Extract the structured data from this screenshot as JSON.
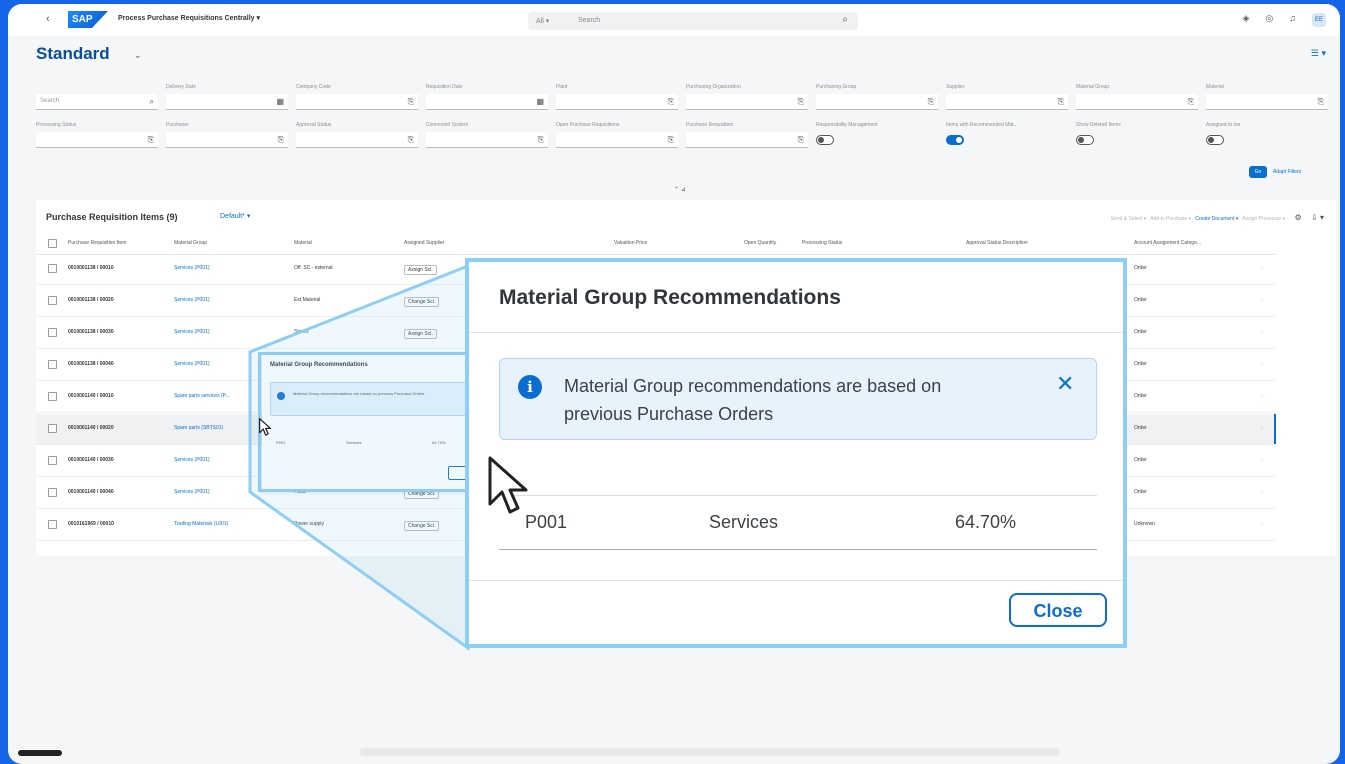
{
  "shell": {
    "app_title": "Process Purchase Requisitions Centrally ▾",
    "search_scope": "All ▾",
    "search_placeholder": "Search",
    "avatar_initials": "EE"
  },
  "variant": {
    "title": "Standard"
  },
  "filters": [
    {
      "label": "",
      "placeholder": "Search",
      "icon": "search-icon"
    },
    {
      "label": "Delivery Date",
      "icon": "calendar-icon"
    },
    {
      "label": "Company Code",
      "icon": "value-help-icon"
    },
    {
      "label": "Requisition Date",
      "icon": "calendar-icon"
    },
    {
      "label": "Plant",
      "icon": "value-help-icon"
    },
    {
      "label": "Purchasing Organization",
      "icon": "value-help-icon"
    },
    {
      "label": "Purchasing Group",
      "icon": "value-help-icon"
    },
    {
      "label": "Supplier",
      "icon": "value-help-icon"
    },
    {
      "label": "Material Group",
      "icon": "value-help-icon"
    },
    {
      "label": "Material",
      "icon": "value-help-icon"
    },
    {
      "label": "Processing Status",
      "icon": "value-help-icon"
    },
    {
      "label": "Purchaser",
      "icon": "value-help-icon"
    },
    {
      "label": "Approval Status",
      "icon": "value-help-icon"
    },
    {
      "label": "Connected System",
      "icon": "value-help-icon"
    },
    {
      "label": "Open Purchase Requisitions",
      "icon": "value-help-icon"
    },
    {
      "label": "Purchase Requisition",
      "icon": "value-help-icon"
    },
    {
      "label": "Responsibility Management",
      "toggle": false
    },
    {
      "label": "Items with Recommended Mat...",
      "toggle": true
    },
    {
      "label": "Show Deleted Items",
      "toggle": false
    },
    {
      "label": "Assigned to me",
      "toggle": false
    }
  ],
  "filter_bar": {
    "go_label": "Go",
    "adapt_label": "Adapt Filters"
  },
  "table": {
    "title": "Purchase Requisition Items (9)",
    "variant": "Default* ▾",
    "actions": [
      "Send & Select ▾",
      "Add to Purchase ▾",
      "Create Document ▾",
      "Assign Processor ▾"
    ],
    "columns": [
      "Purchase Requisition Item",
      "Material Group",
      "Material",
      "Assigned Supplier",
      "Valuation Price",
      "Open Quantity",
      "Processing Status",
      "Approval Status Description",
      "Account Assignment Catego..."
    ],
    "rows": [
      {
        "id": "0010001138 / 00010",
        "group": "Services (P001)",
        "material": "Off. SC - external",
        "supplier": "Assign Sci.",
        "acct": "Order"
      },
      {
        "id": "0010001138 / 00020",
        "group": "Services (P001)",
        "material": "Ext Material",
        "supplier": "Change Sci.",
        "acct": "Order"
      },
      {
        "id": "0010001138 / 00030",
        "group": "Services (P001)",
        "material": "Stores",
        "supplier": "Assign Sci.",
        "acct": "Order"
      },
      {
        "id": "0010001138 / 00040",
        "group": "Services (P001)",
        "material": "",
        "supplier": "",
        "acct": "Order"
      },
      {
        "id": "0010001140 / 00010",
        "group": "Spare parts services (P...",
        "material": "",
        "supplier": "",
        "acct": "Order"
      },
      {
        "id": "0010001140 / 00020",
        "group": "Spare parts (SBTS01)",
        "material": "",
        "supplier": "",
        "acct": "Order"
      },
      {
        "id": "0010001140 / 00030",
        "group": "Services (P001)",
        "material": "",
        "supplier": "",
        "acct": "Order"
      },
      {
        "id": "0010001140 / 00040",
        "group": "Services (P001)",
        "material": "Food",
        "supplier": "Change Sci.",
        "acct": "Order"
      },
      {
        "id": "0010161969 / 00010",
        "group": "Trading Materials (L001)",
        "material": "Power supply",
        "supplier": "Change Sci.",
        "acct": "Unknown"
      }
    ]
  },
  "mini_popover": {
    "title": "Material Group Recommendations",
    "message": "Material Group recommendations are based on previous Purchase Orders",
    "row": [
      "P001",
      "Services",
      "64.70%"
    ]
  },
  "dialog": {
    "title": "Material Group Recommendations",
    "message": "Material Group recommendations are based on previous Purchase Orders",
    "row": {
      "code": "P001",
      "group": "Services",
      "confidence": "64.70%"
    },
    "close_label": "Close"
  },
  "colors": {
    "accent": "#0a6ed1",
    "frame": "#8ecdf4",
    "info_bg": "#e8f2fc",
    "background": "#1565e8"
  }
}
